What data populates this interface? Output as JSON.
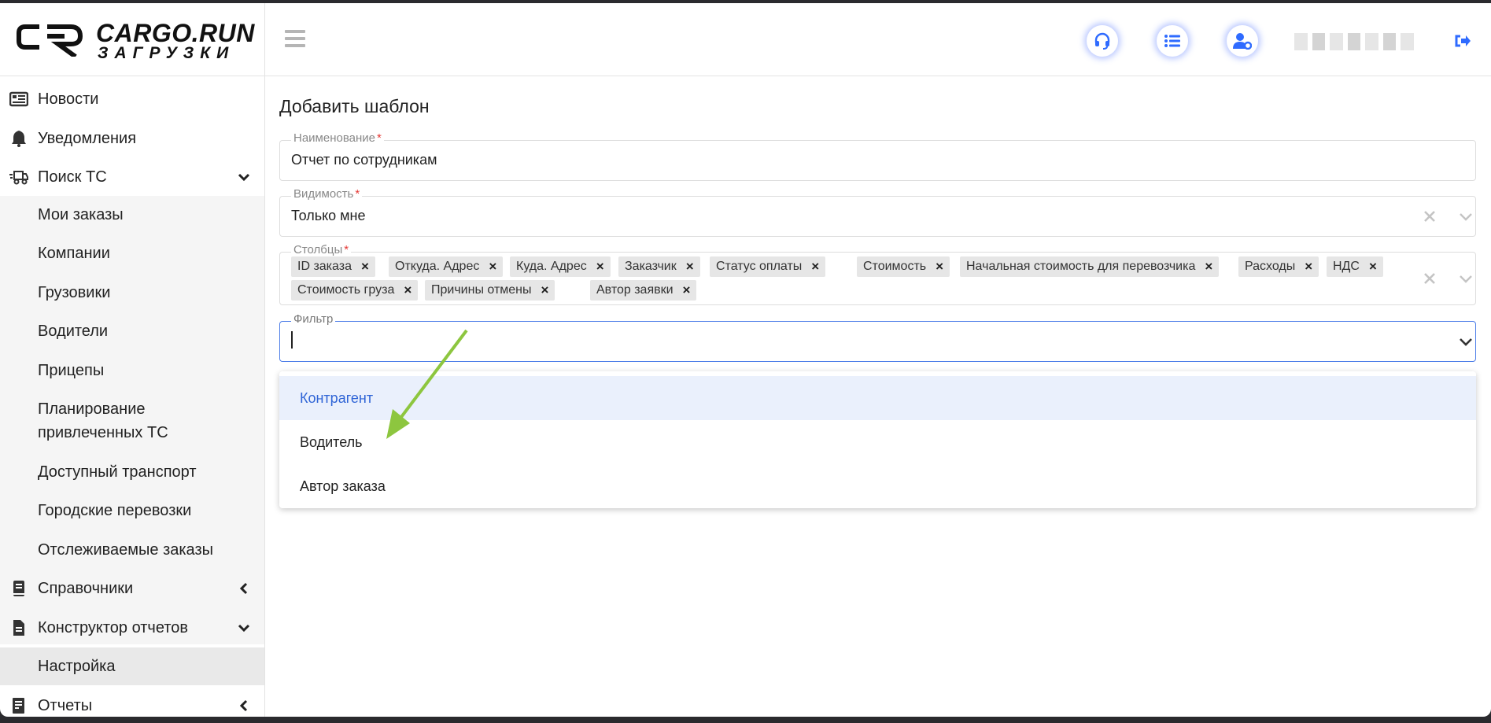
{
  "brand": {
    "line1": "CARGO.RUN",
    "line2": "ЗАГРУЗКИ"
  },
  "sidebar": {
    "items": [
      {
        "label": "Новости",
        "icon": "newspaper-icon"
      },
      {
        "label": "Уведомления",
        "icon": "bell-icon"
      },
      {
        "label": "Поиск ТС",
        "icon": "truck-fast-icon",
        "expanded": true
      }
    ],
    "search_sub": [
      "Мои заказы",
      "Компании",
      "Грузовики",
      "Водители",
      "Прицепы",
      "Планирование\nпривлеченных ТС",
      "Доступный транспорт",
      "Городские перевозки",
      "Отслеживаемые заказы"
    ],
    "refs": {
      "label": "Справочники",
      "icon": "book-icon"
    },
    "builder": {
      "label": "Конструктор отчетов",
      "icon": "file-icon"
    },
    "builder_sub": [
      "Настройка"
    ],
    "reports": {
      "label": "Отчеты",
      "icon": "report-icon"
    }
  },
  "form": {
    "title": "Добавить шаблон",
    "name": {
      "label": "Наименование",
      "required": "*",
      "value": "Отчет по сотрудникам"
    },
    "visibility": {
      "label": "Видимость",
      "required": "*",
      "value": "Только мне"
    },
    "columns": {
      "label": "Столбцы",
      "required": "*",
      "chips": [
        "ID заказа",
        "Откуда. Адрес",
        "Куда. Адрес",
        "Заказчик",
        "Статус оплаты",
        "Стоимость",
        "Начальная стоимость для перевозчика",
        "Расходы",
        "НДС",
        "Стоимость груза",
        "Причины отмены",
        "Автор заявки"
      ]
    },
    "filter": {
      "label": "Фильтр",
      "options": [
        "Контрагент",
        "Водитель",
        "Автор заказа"
      ],
      "highlighted": "Контрагент"
    }
  },
  "colors": {
    "accent": "#4f7fe8",
    "highlight": "#eaf0fc",
    "arrow": "#8dc63f",
    "required": "#e53935"
  }
}
